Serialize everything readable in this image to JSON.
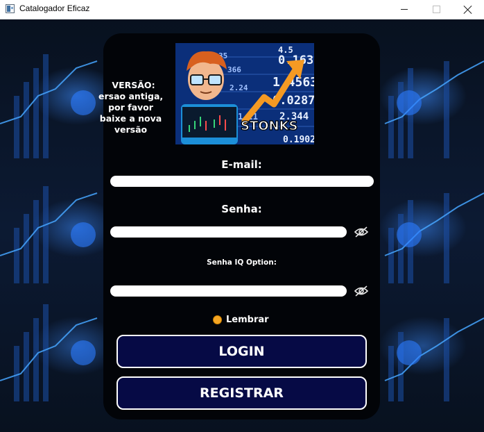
{
  "window": {
    "title": "Catalogador Eficaz",
    "icon": "app-window-icon"
  },
  "version_notice": {
    "title": "VERSÃO:",
    "lines": [
      "ersao antiga,",
      "por favor",
      "baixe a nova",
      "versão"
    ]
  },
  "banner": {
    "caption": "STONKS",
    "numbers": [
      "0.163",
      "4.5",
      "1.4563",
      "0.0287",
      "2.344",
      "1.21",
      "0.1902",
      "35",
      "366",
      "2.24"
    ],
    "colors": {
      "background": "#0b2f7a",
      "arrow": "#f59a23"
    }
  },
  "form": {
    "email_label": "E-mail:",
    "email_value": "",
    "password_label": "Senha:",
    "password_value": "",
    "iq_password_label": "Senha IQ Option:",
    "iq_password_value": "",
    "remember_label": "Lembrar",
    "remember_checked": true
  },
  "buttons": {
    "login_label": "LOGIN",
    "register_label": "REGISTRAR"
  },
  "colors": {
    "card": "#020408",
    "button_fill": "#060a45",
    "button_border": "#ffffff",
    "radio": "#f5a623"
  }
}
